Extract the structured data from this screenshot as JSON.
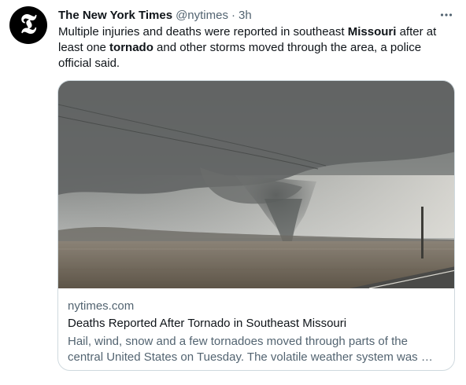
{
  "author": {
    "name": "The New York Times",
    "handle": "@nytimes",
    "separator": "·",
    "time": "3h",
    "avatar_icon": "nyt-logo"
  },
  "tweet": {
    "segments": [
      {
        "text": "Multiple injuries and deaths were reported in southeast ",
        "bold": false
      },
      {
        "text": "Missouri",
        "bold": true
      },
      {
        "text": " after at least one ",
        "bold": false
      },
      {
        "text": "tornado",
        "bold": true
      },
      {
        "text": " and other storms moved through the area, a police official said.",
        "bold": false
      }
    ]
  },
  "more_icon": "more-horizontal-icon",
  "card": {
    "domain": "nytimes.com",
    "title": "Deaths Reported After Tornado in Southeast Missouri",
    "description": "Hail, wind, snow and a few tornadoes moved through parts of the central United States on Tuesday. The volatile weather system was …"
  },
  "colors": {
    "text": "#0f1419",
    "secondary": "#536471",
    "border": "#cfd9de"
  }
}
